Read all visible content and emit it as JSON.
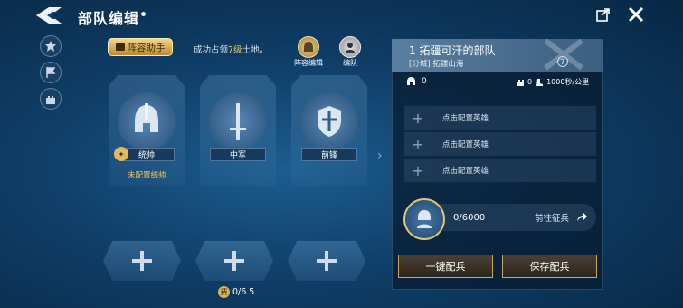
{
  "header": {
    "title": "部队编辑"
  },
  "top": {
    "assistant_label": "阵容助手",
    "notice_prefix": "成功占领",
    "notice_level": "7级",
    "notice_suffix": "土地。",
    "lineup_label": "阵容编辑",
    "team_label": "编队"
  },
  "slots": [
    {
      "role": "统帅",
      "status": "未配置统帅"
    },
    {
      "role": "中军"
    },
    {
      "role": "前锋"
    }
  ],
  "cost": {
    "icon_char": "费",
    "value": "0/6.5"
  },
  "panel": {
    "title": "1 拓疆可汗的部队",
    "subtitle": "[分城] 拓疆山海",
    "help_char": "?",
    "power": "0",
    "siege": "0",
    "speed": "1000秒/公里",
    "hero_rows": [
      {
        "label": "点击配置英雄"
      },
      {
        "label": "点击配置英雄"
      },
      {
        "label": "点击配置英雄"
      }
    ],
    "troops": "0/6000",
    "recruit_label": "前往征兵",
    "btn_one_key": "一键配兵",
    "btn_save": "保存配兵"
  },
  "colors": {
    "gold": "#f1c85b",
    "panel_bg": "#081a2e",
    "accent_blue": "#5a7e9f"
  }
}
